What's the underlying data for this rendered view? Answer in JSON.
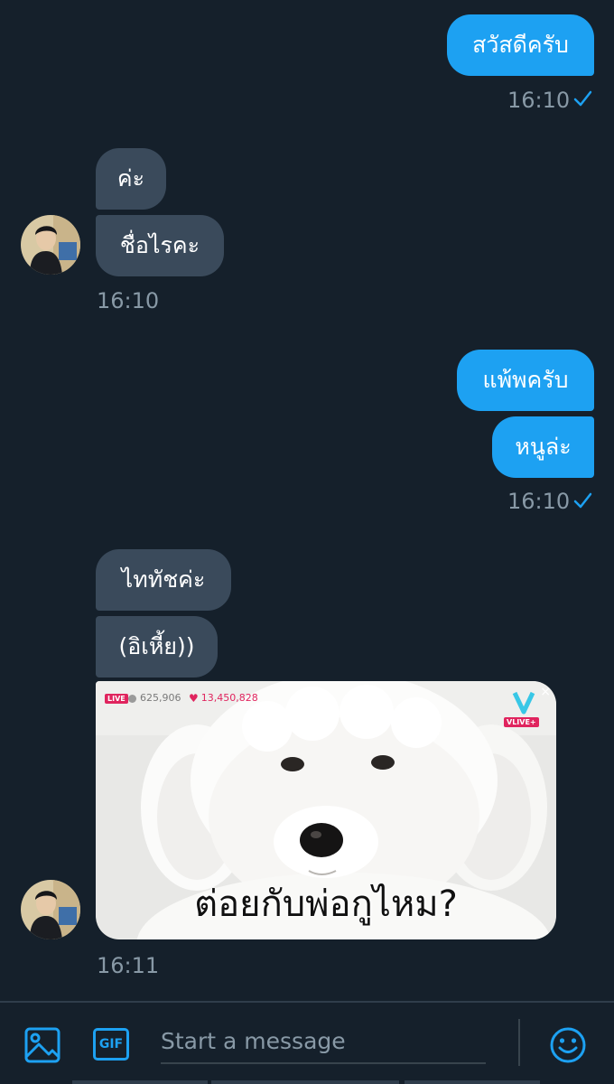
{
  "conversation": {
    "outgoing_1": {
      "text": "สวัสดีครับ",
      "time": "16:10"
    },
    "incoming_1": {
      "messages": [
        "ค่ะ",
        "ชื่อไรคะ"
      ],
      "time": "16:10"
    },
    "outgoing_2": {
      "messages": [
        "แพ้พครับ",
        "หนูล่ะ"
      ],
      "time": "16:10"
    },
    "incoming_2": {
      "messages": [
        "ไททัชค่ะ",
        "(อิเหี้ย))"
      ],
      "media": {
        "live_label": "LIVE",
        "viewers": "625,906",
        "hearts": "13,450,828",
        "channel_label": "VLIVE+",
        "close_glyph": "×",
        "caption": "ต่อยกับพ่อกูไหม?"
      },
      "time": "16:11"
    }
  },
  "composer": {
    "placeholder": "Start a message",
    "gif_label": "GIF"
  },
  "icons": {
    "read_receipt": "check-icon",
    "image": "image-icon",
    "gif": "gif-icon",
    "emoji": "smile-icon"
  },
  "colors": {
    "background": "#15202b",
    "outgoing_bubble": "#1da1f2",
    "incoming_bubble": "#3a4a5b",
    "timestamp": "#8899a6",
    "accent": "#1da1f2"
  }
}
